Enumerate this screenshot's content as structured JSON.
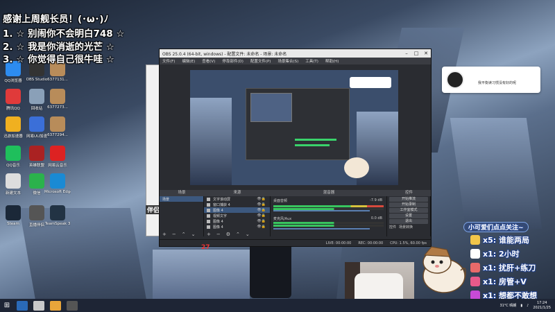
{
  "overlay": {
    "line1": "感谢上周舰长员！(･ω･)ﾉ",
    "line2": "1. ☆  别闹你不会明白748   ☆",
    "line3": "2. ☆  我是你消逝的光芒   ☆",
    "line4": "3. ☆  你觉得自己很牛哇   ☆"
  },
  "desktop_icons": [
    {
      "label": "QQ浏览器",
      "color": "#2d8cf0"
    },
    {
      "label": "OBS Studio",
      "color": "#333"
    },
    {
      "label": "6377131...",
      "color": "#b88c5a"
    },
    {
      "label": "腾讯QQ",
      "color": "#e03a3a"
    },
    {
      "label": "回收站",
      "color": "#8aa0b8"
    },
    {
      "label": "6377273...",
      "color": "#b88c5a"
    },
    {
      "label": "迅游加速器",
      "color": "#f0b020"
    },
    {
      "label": "网易UU加速",
      "color": "#3b6fd8"
    },
    {
      "label": "6377294...",
      "color": "#b88c5a"
    },
    {
      "label": "QQ音乐",
      "color": "#1fbf5c"
    },
    {
      "label": "英雄联盟",
      "color": "#a22"
    },
    {
      "label": "网易云音乐",
      "color": "#d22"
    },
    {
      "label": "新建文本",
      "color": "#ddd"
    },
    {
      "label": "微信",
      "color": "#2bb24c"
    },
    {
      "label": "Microsoft Edge",
      "color": "#1a8ad4"
    },
    {
      "label": "Steam",
      "color": "#1b2838"
    },
    {
      "label": "直播伴侣",
      "color": "#555"
    },
    {
      "label": "TeamSpeak 3",
      "color": "#234"
    }
  ],
  "obs": {
    "title": "OBS 25.0.4 (64-bit, windows) - 配置文件: 未命名 - 场景: 未命名",
    "menu": [
      "文件(F)",
      "编辑(E)",
      "查看(V)",
      "停靠部件(D)",
      "配置文件(P)",
      "场景集合(S)",
      "工具(T)",
      "帮助(H)"
    ],
    "docks": {
      "scenes": "场景",
      "sources": "来源",
      "mixer": "混音器",
      "controls": "控件"
    },
    "scene_item": "场景",
    "sources": [
      "文字滚动屏",
      "窗口捕获 4",
      "图像 4",
      "视频文字",
      "图像 4",
      "图像 4"
    ],
    "mixer": [
      {
        "name": "桌面音频",
        "db": "-7.9 dB"
      },
      {
        "name": "麦克风/Aux",
        "db": "0.0 dB"
      }
    ],
    "controls": [
      "开始推流",
      "开始录制",
      "工作室模式",
      "设置",
      "退出"
    ],
    "control_tabs": [
      "控件",
      "场景转换"
    ],
    "status": {
      "live": "LIVE: 00:00:00",
      "rec": "REC: 00:00:00",
      "cpu": "CPU: 1.5%, 60.00 fps"
    }
  },
  "side_window": {
    "label": "伴侣",
    "counter": "27"
  },
  "chat": {
    "message": "我平衡读习惯没有好的呢"
  },
  "gifts": {
    "title": "小可爱们点点关注~",
    "items": [
      {
        "text": "x5: 谁能两局",
        "color": "#f2c64a"
      },
      {
        "text": "x1: 2小时",
        "color": "#ffffff"
      },
      {
        "text": "x1: 扰肝+练刀",
        "color": "#e86a6a"
      },
      {
        "text": "x1: 房管+V",
        "color": "#e85a8a"
      },
      {
        "text": "x1: 想都不敢想",
        "color": "#c74ad8"
      }
    ]
  },
  "taskbar": {
    "start": "⊞",
    "tray_temp": "31°C 晴朗",
    "time": "17:24",
    "date": "2021/1/25"
  }
}
